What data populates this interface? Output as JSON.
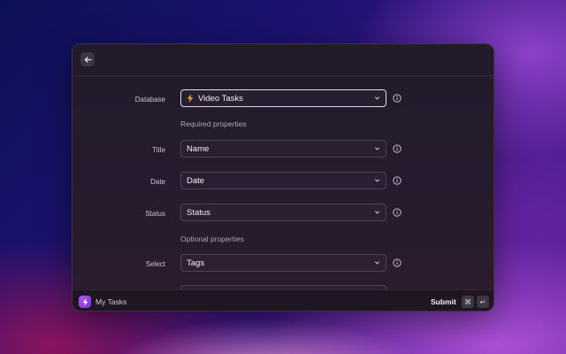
{
  "footer": {
    "app_name": "My Tasks",
    "submit_label": "Submit",
    "shortcut_keys": [
      "⌘",
      "↵"
    ]
  },
  "form": {
    "database": {
      "label": "Database",
      "value": "Video Tasks"
    },
    "required_heading": "Required properties",
    "title": {
      "label": "Title",
      "value": "Name"
    },
    "date": {
      "label": "Date",
      "value": "Date"
    },
    "status": {
      "label": "Status",
      "value": "Status"
    },
    "optional_heading": "Optional properties",
    "select": {
      "label": "Select",
      "value": "Tags"
    }
  },
  "icons": {
    "back": "arrow-left-icon",
    "database": "lightning-bolt-icon",
    "dropdown": "chevron-down-icon",
    "info": "info-circle-icon",
    "app": "lightning-bolt-icon"
  },
  "colors": {
    "accent": "#a34ee8",
    "bolt": "#f5a623"
  }
}
